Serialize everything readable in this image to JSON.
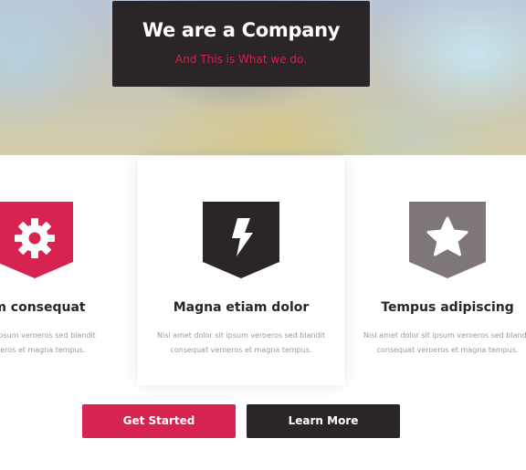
{
  "hero": {
    "title": "We are a Company",
    "subtitle": "And This is What we do."
  },
  "colors": {
    "accent": "#d72350",
    "dark": "#2a2526",
    "muted": "#7f7677"
  },
  "features": [
    {
      "icon": "gear-icon",
      "color": "#d72350",
      "title": "um consequat",
      "text_line1": "lor sit ipsum veroeros sed blandit",
      "text_line2": "veroeros et magna tempus."
    },
    {
      "icon": "lightning-icon",
      "color": "#2a2526",
      "title": "Magna etiam dolor",
      "text_line1": "Nisl amet dolor sit ipsum veroeros sed blandit",
      "text_line2": "consequat veroeros et magna tempus."
    },
    {
      "icon": "star-icon",
      "color": "#7f7677",
      "title": "Tempus adipiscing",
      "text_line1": "Nisl amet dolor sit ipsum veroeros sed blandit",
      "text_line2": "consequat veroeros et magna tempus."
    }
  ],
  "actions": {
    "primary_label": "Get Started",
    "secondary_label": "Learn More"
  }
}
